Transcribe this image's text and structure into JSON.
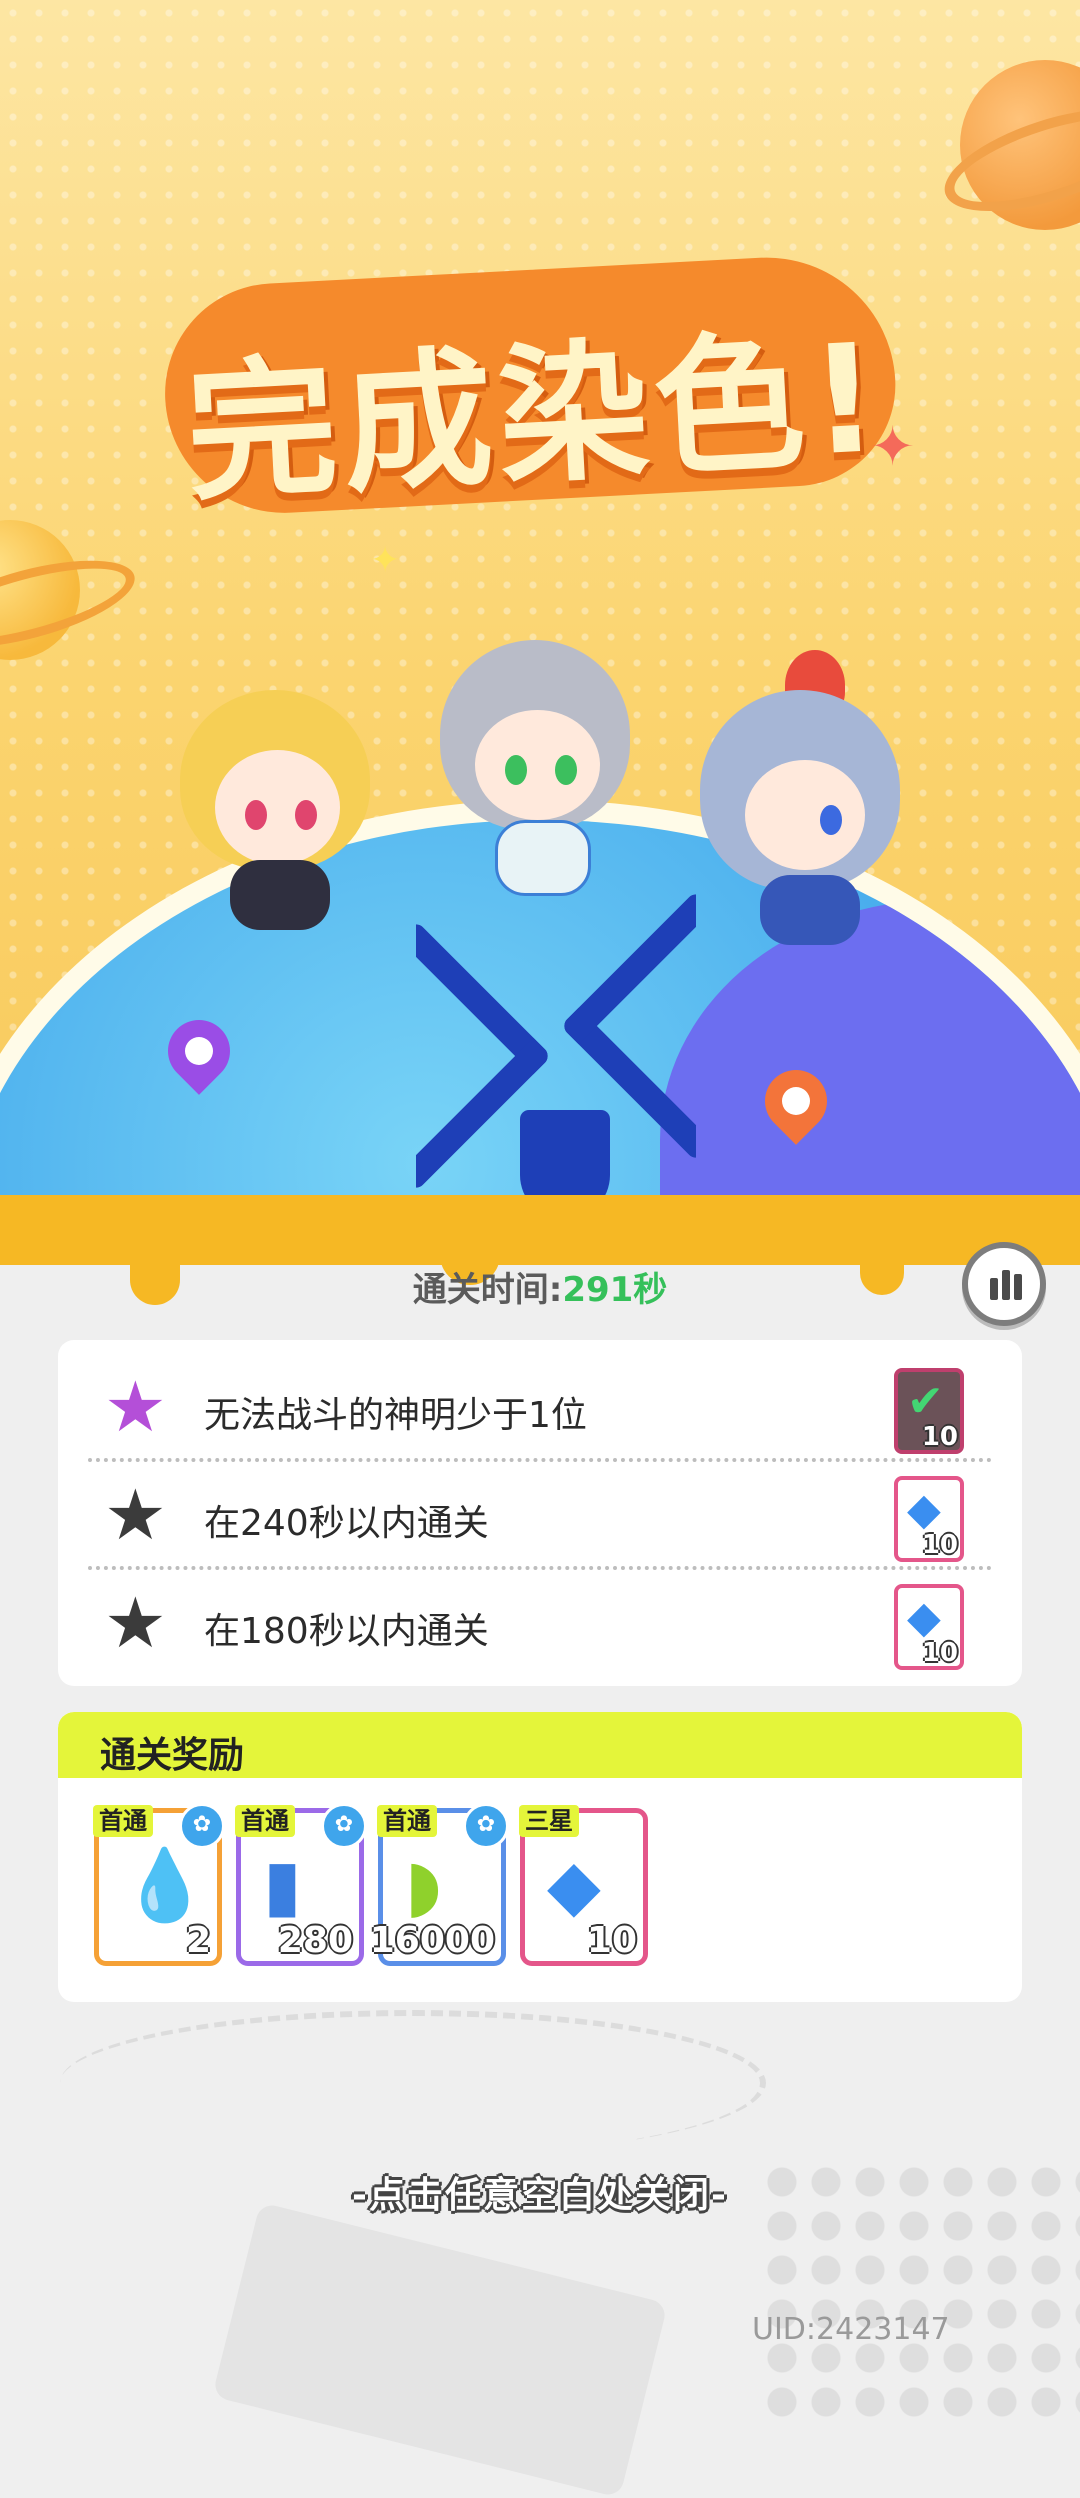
{
  "banner": {
    "title": "完成染色!"
  },
  "result": {
    "time_label": "通关时间:",
    "time_value": "291秒"
  },
  "objectives": [
    {
      "text": "无法战斗的神明少于1位",
      "completed": true,
      "reward_icon": "check-icon",
      "reward_qty": "10"
    },
    {
      "text": "在240秒以内通关",
      "completed": false,
      "reward_icon": "diamond-icon",
      "reward_qty": "10"
    },
    {
      "text": "在180秒以内通关",
      "completed": false,
      "reward_icon": "diamond-icon",
      "reward_qty": "10"
    }
  ],
  "rewards": {
    "title": "通关奖励",
    "items": [
      {
        "tag": "首通",
        "icon": "water-drop-icon",
        "qty": "2",
        "rarity_color": "#f5a136"
      },
      {
        "tag": "首通",
        "icon": "spray-can-icon",
        "qty": "280",
        "rarity_color": "#9b6ae8"
      },
      {
        "tag": "首通",
        "icon": "paint-tube-icon",
        "qty": "16000",
        "rarity_color": "#5a8fe8"
      },
      {
        "tag": "三星",
        "icon": "diamond-icon",
        "qty": "10",
        "rarity_color": "#e4568a"
      }
    ]
  },
  "close_hint": "-点击任意空白处关闭-",
  "uid": "UID:2423147",
  "colors": {
    "accent_yellow": "#e4f53a",
    "time_green": "#35c05a",
    "banner_orange": "#f58a2c"
  }
}
